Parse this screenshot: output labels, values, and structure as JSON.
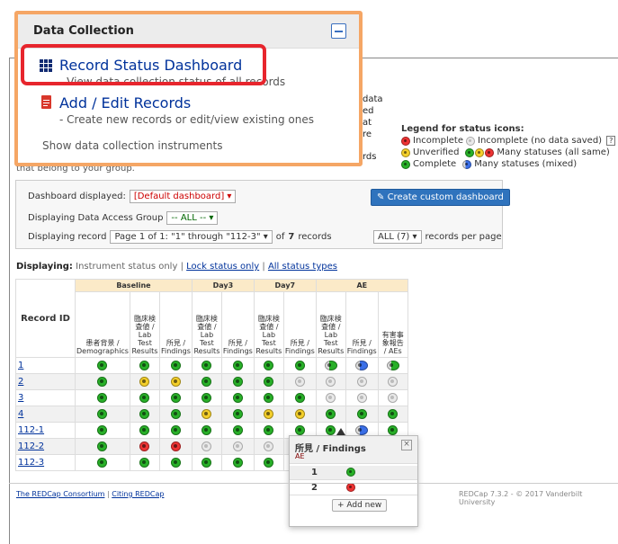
{
  "menu": {
    "title": "Data Collection",
    "items": [
      {
        "label": "Record Status Dashboard",
        "sub": "- View data collection status of all records"
      },
      {
        "label": "Add / Edit Records",
        "sub": "- Create new records or edit/view existing ones"
      }
    ],
    "show_instruments": "Show data collection instruments"
  },
  "background_fragments": [
    "data",
    "ed",
    "at",
    "re",
    "rds",
    "that belong to your group."
  ],
  "legend": {
    "title": "Legend for status icons:",
    "incomplete": "Incomplete",
    "incomplete_nosave": "Incomplete (no data saved)",
    "help": "?",
    "unverified": "Unverified",
    "many_same": "Many statuses (all same)",
    "complete": "Complete",
    "many_mixed": "Many statuses (mixed)"
  },
  "controls": {
    "dashboard_label": "Dashboard displayed:",
    "dashboard_value": "[Default dashboard]",
    "dag_label": "Displaying Data Access Group",
    "dag_value": "-- ALL --",
    "record_label": "Displaying record",
    "record_value": "Page 1 of 1: \"1\" through \"112-3\"",
    "of_text": "of",
    "total": "7",
    "records_text": "records",
    "per_page_value": "ALL (7)",
    "per_page_label": "records per page",
    "create_button": "Create custom dashboard"
  },
  "displaying": {
    "label": "Displaying:",
    "current": "Instrument status only",
    "sep": "|",
    "lock": "Lock status only",
    "all": "All status types"
  },
  "table": {
    "record_header": "Record ID",
    "events": [
      {
        "name": "Baseline",
        "span": 3
      },
      {
        "name": "Day3",
        "span": 2
      },
      {
        "name": "Day7",
        "span": 2
      },
      {
        "name": "AE",
        "span": 3
      }
    ],
    "instruments": [
      {
        "lines": [
          "患者背景 /",
          "Demographics"
        ]
      },
      {
        "lines": [
          "臨床検",
          "査値 /",
          "Lab",
          "Test",
          "Results"
        ]
      },
      {
        "lines": [
          "所見 /",
          "Findings"
        ]
      },
      {
        "lines": [
          "臨床検",
          "査値 /",
          "Lab",
          "Test",
          "Results"
        ]
      },
      {
        "lines": [
          "所見 /",
          "Findings"
        ]
      },
      {
        "lines": [
          "臨床検",
          "査値 /",
          "Lab",
          "Test",
          "Results"
        ]
      },
      {
        "lines": [
          "所見 /",
          "Findings"
        ]
      },
      {
        "lines": [
          "臨床検",
          "査値 /",
          "Lab",
          "Test",
          "Results"
        ]
      },
      {
        "lines": [
          "所見 /",
          "Findings"
        ]
      },
      {
        "lines": [
          "有害事",
          "象報告",
          "/ AEs"
        ]
      }
    ],
    "rows": [
      {
        "id": "1",
        "status": [
          "green",
          "green",
          "green",
          "green",
          "green",
          "green",
          "green",
          "multi-green",
          "multi-blue",
          "multi-green"
        ]
      },
      {
        "id": "2",
        "status": [
          "green",
          "yellow",
          "yellow",
          "green",
          "green",
          "green",
          "gray",
          "gray",
          "gray",
          "gray"
        ]
      },
      {
        "id": "3",
        "status": [
          "green",
          "green",
          "green",
          "green",
          "green",
          "green",
          "green",
          "gray",
          "gray",
          "gray"
        ]
      },
      {
        "id": "4",
        "status": [
          "green",
          "green",
          "green",
          "yellow",
          "green",
          "yellow",
          "yellow",
          "green",
          "green",
          "green"
        ]
      },
      {
        "id": "112-1",
        "status": [
          "green",
          "green",
          "green",
          "green",
          "green",
          "green",
          "green",
          "green",
          "multi-blue",
          "green"
        ]
      },
      {
        "id": "112-2",
        "status": [
          "green",
          "red",
          "red",
          "gray",
          "gray",
          "gray",
          "none",
          "none",
          "none",
          "none"
        ]
      },
      {
        "id": "112-3",
        "status": [
          "green",
          "green",
          "green",
          "green",
          "green",
          "green",
          "green",
          "none",
          "none",
          "none"
        ]
      }
    ]
  },
  "popup": {
    "title": "所見 / Findings",
    "event": "AE",
    "close": "×",
    "rows": [
      {
        "n": "1",
        "status": "green"
      },
      {
        "n": "2",
        "status": "red"
      }
    ],
    "add_new": "+ Add new"
  },
  "footer": {
    "link1": "The REDCap Consortium",
    "sep": "|",
    "link2": "Citing REDCap",
    "version": "REDCap 7.3.2 - © 2017 Vanderbilt University"
  }
}
